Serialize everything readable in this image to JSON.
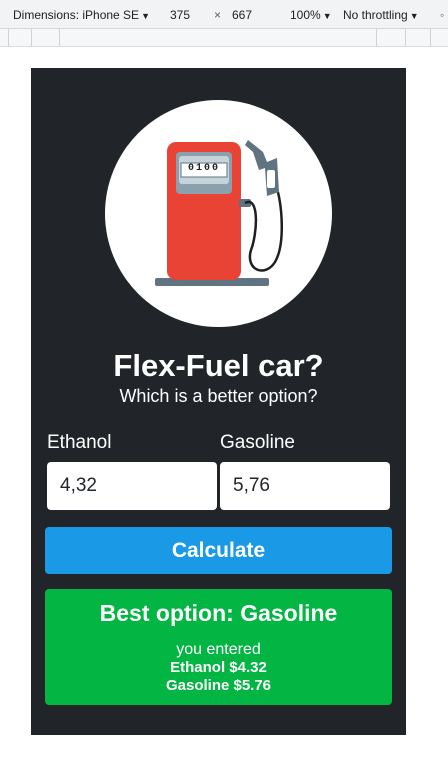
{
  "devtools": {
    "device_label": "Dimensions: iPhone SE",
    "width_value": "375",
    "times_sign": "×",
    "height_value": "667",
    "zoom_label": "100%",
    "throttling_label": "No throttling"
  },
  "app": {
    "pump_display": "0100",
    "title": "Flex-Fuel car?",
    "subtitle": "Which is a better option?",
    "ethanol_label": "Ethanol",
    "gasoline_label": "Gasoline",
    "ethanol_value": "4,32",
    "gasoline_value": "5,76",
    "calculate_label": "Calculate",
    "result": {
      "title": "Best option: Gasoline",
      "entered_label": "you entered",
      "ethanol_line": "Ethanol $4.32",
      "gasoline_line": "Gasoline $5.76"
    }
  },
  "colors": {
    "background": "#212529",
    "button": "#1a99e6",
    "result": "#03b543",
    "pump_red": "#e94335"
  }
}
